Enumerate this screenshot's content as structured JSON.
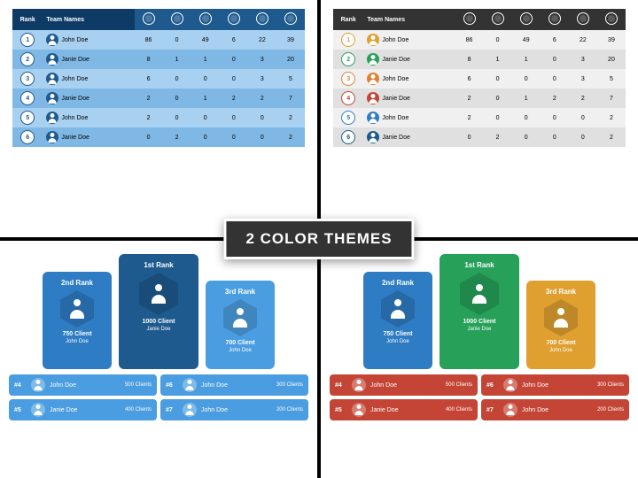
{
  "badge": "2 COLOR THEMES",
  "table_headers": {
    "rank": "Rank",
    "team": "Team Names"
  },
  "rows": [
    {
      "r": "1",
      "name": "John Doe",
      "v": [
        86,
        0,
        49,
        6,
        22,
        39
      ]
    },
    {
      "r": "2",
      "name": "Janie Doe",
      "v": [
        8,
        1,
        1,
        0,
        3,
        20
      ]
    },
    {
      "r": "3",
      "name": "John Doe",
      "v": [
        6,
        0,
        0,
        0,
        3,
        5
      ]
    },
    {
      "r": "4",
      "name": "Janie Doe",
      "v": [
        2,
        0,
        1,
        2,
        2,
        7
      ]
    },
    {
      "r": "5",
      "name": "John Doe",
      "v": [
        2,
        0,
        0,
        0,
        0,
        2
      ]
    },
    {
      "r": "6",
      "name": "Janie Doe",
      "v": [
        0,
        2,
        0,
        0,
        0,
        2
      ]
    }
  ],
  "medal_colors": [
    "#e0a030",
    "#27a05a",
    "#e08030",
    "#c44536",
    "#2e7cc4",
    "#1e5a8e"
  ],
  "podium": {
    "first": {
      "rank": "1st Rank",
      "clients": "1000 Client",
      "name": "Janie Doe"
    },
    "second": {
      "rank": "2nd Rank",
      "clients": "750 Client",
      "name": "John Doe"
    },
    "third": {
      "rank": "3rd Rank",
      "clients": "700 Client",
      "name": "John Doe"
    }
  },
  "list": [
    {
      "num": "#4",
      "name": "John Doe",
      "ct": "500 Clients"
    },
    {
      "num": "#6",
      "name": "John Doe",
      "ct": "300 Clients"
    },
    {
      "num": "#5",
      "name": "Janie Doe",
      "ct": "400 Clients"
    },
    {
      "num": "#7",
      "name": "John Doe",
      "ct": "200 Clients"
    }
  ]
}
